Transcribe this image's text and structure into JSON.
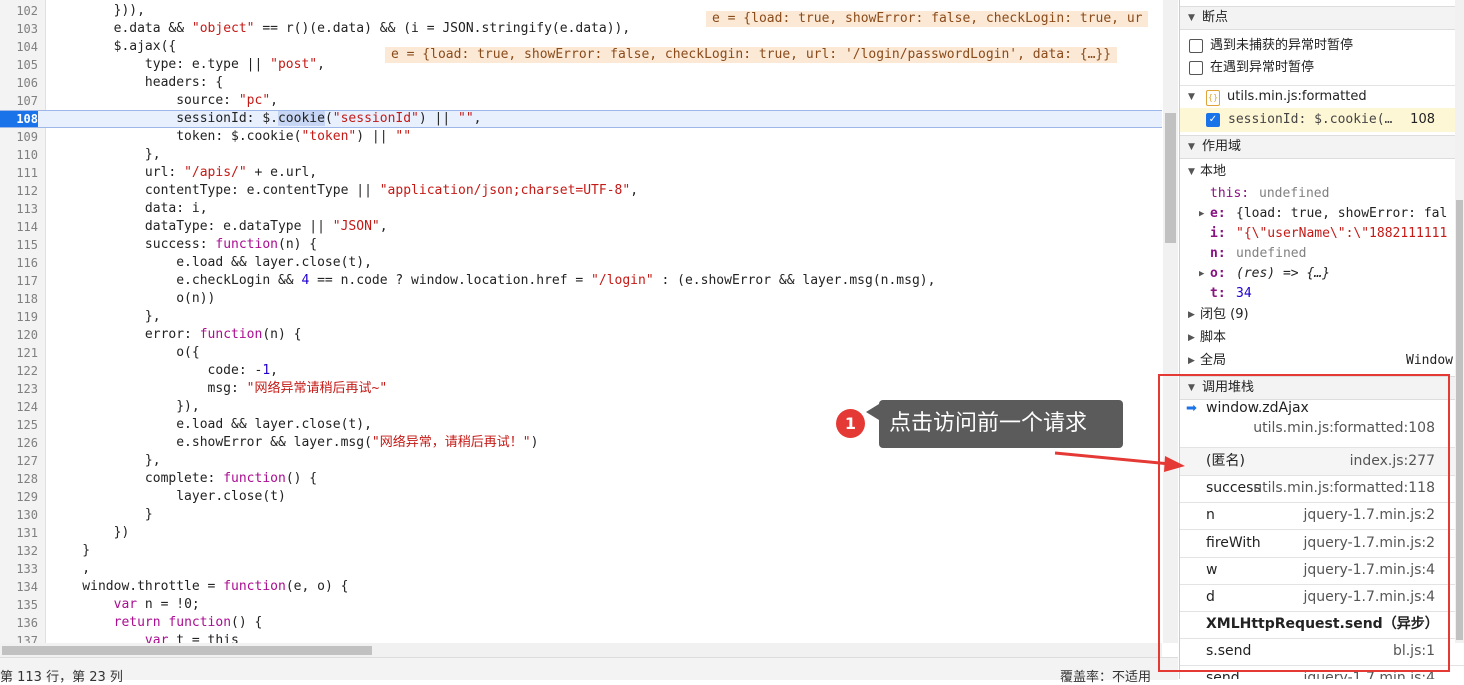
{
  "editor": {
    "lines": [
      {
        "n": "102",
        "code": "        })),"
      },
      {
        "n": "103",
        "code": "        e.data && \"object\" == r()(e.data) && (i = JSON.stringify(e.data)),"
      },
      {
        "n": "104",
        "code": "        $.ajax({"
      },
      {
        "n": "105",
        "code": "            type: e.type || \"post\","
      },
      {
        "n": "106",
        "code": "            headers: {"
      },
      {
        "n": "107",
        "code": "                source: \"pc\","
      },
      {
        "n": "108",
        "code": "                sessionId: $.cookie(\"sessionId\") || \"\","
      },
      {
        "n": "109",
        "code": "                token: $.cookie(\"token\") || \"\""
      },
      {
        "n": "110",
        "code": "            },"
      },
      {
        "n": "111",
        "code": "            url: \"/apis/\" + e.url,"
      },
      {
        "n": "112",
        "code": "            contentType: e.contentType || \"application/json;charset=UTF-8\","
      },
      {
        "n": "113",
        "code": "            data: i,"
      },
      {
        "n": "114",
        "code": "            dataType: e.dataType || \"JSON\","
      },
      {
        "n": "115",
        "code": "            success: function(n) {"
      },
      {
        "n": "116",
        "code": "                e.load && layer.close(t),"
      },
      {
        "n": "117",
        "code": "                e.checkLogin && 4 == n.code ? window.location.href = \"/login\" : (e.showError && layer.msg(n.msg),"
      },
      {
        "n": "118",
        "code": "                o(n))"
      },
      {
        "n": "119",
        "code": "            },"
      },
      {
        "n": "120",
        "code": "            error: function(n) {"
      },
      {
        "n": "121",
        "code": "                o({"
      },
      {
        "n": "122",
        "code": "                    code: -1,"
      },
      {
        "n": "123",
        "code": "                    msg: \"网络异常请稍后再试~\""
      },
      {
        "n": "124",
        "code": "                }),"
      },
      {
        "n": "125",
        "code": "                e.load && layer.close(t),"
      },
      {
        "n": "126",
        "code": "                e.showError && layer.msg(\"网络异常，请稍后再试！\")"
      },
      {
        "n": "127",
        "code": "            },"
      },
      {
        "n": "128",
        "code": "            complete: function() {"
      },
      {
        "n": "129",
        "code": "                layer.close(t)"
      },
      {
        "n": "130",
        "code": "            }"
      },
      {
        "n": "131",
        "code": "        })"
      },
      {
        "n": "132",
        "code": "    }"
      },
      {
        "n": "133",
        "code": "    ,"
      },
      {
        "n": "134",
        "code": "    window.throttle = function(e, o) {"
      },
      {
        "n": "135",
        "code": "        var n = !0;"
      },
      {
        "n": "136",
        "code": "        return function() {"
      },
      {
        "n": "137",
        "code": "            var t = this"
      }
    ],
    "inline_values": {
      "line103": "e = {load: true, showError: false, checkLogin: true, ur",
      "line105": "e = {load: true, showError: false, checkLogin: true, url: '/login/passwordLogin', data: {…}}"
    },
    "active_line": "108"
  },
  "status": {
    "left": "第 113 行，第 23 列",
    "right": "覆盖率：不适用"
  },
  "panel": {
    "breakpoints_header": "断点",
    "pause_uncaught": "遇到未捕获的异常时暂停",
    "pause_caught": "在遇到异常时暂停",
    "bp_file": "utils.min.js:formatted",
    "bp_code": "sessionId: $.cookie(…",
    "bp_line": "108",
    "scope_header": "作用域",
    "local_header": "本地",
    "scope": {
      "this_k": "this:",
      "this_v": "undefined",
      "e_k": "e:",
      "e_v": "{load: true, showError: fal",
      "i_k": "i:",
      "i_v": "\"{\\\"userName\\\":\\\"1882111111",
      "n_k": "n:",
      "n_v": "undefined",
      "o_k": "o:",
      "o_v": "(res) => {…}",
      "t_k": "t:",
      "t_v": "34"
    },
    "closure": "闭包 (9)",
    "script": "脚本",
    "global": "全局",
    "global_val": "Window",
    "callstack_header": "调用堆栈",
    "stack": [
      {
        "fn": "window.zdAjax",
        "loc": "utils.min.js:formatted:108"
      },
      {
        "fn": "(匿名)",
        "loc": "index.js:277"
      },
      {
        "fn": "success",
        "loc": "utils.min.js:formatted:118"
      },
      {
        "fn": "n",
        "loc": "jquery-1.7.min.js:2"
      },
      {
        "fn": "fireWith",
        "loc": "jquery-1.7.min.js:2"
      },
      {
        "fn": "w",
        "loc": "jquery-1.7.min.js:4"
      },
      {
        "fn": "d",
        "loc": "jquery-1.7.min.js:4"
      }
    ],
    "xhr_separator": "XMLHttpRequest.send（异步）",
    "stack_after": [
      {
        "fn": "s.send",
        "loc": "bl.js:1"
      },
      {
        "fn": "send",
        "loc": "jquery-1.7.min.js:4"
      }
    ]
  },
  "annotation": {
    "badge": "1",
    "text": "点击访问前一个请求"
  },
  "colors": {
    "accent": "#1a73e8",
    "annotation_red": "#e53935",
    "callout_bg": "#5b5b5b"
  }
}
